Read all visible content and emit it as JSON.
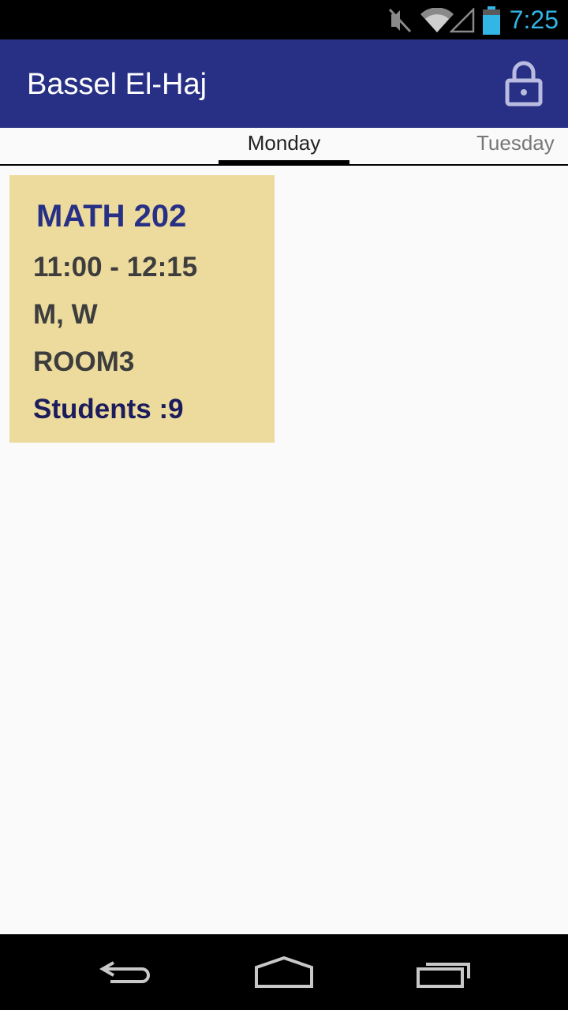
{
  "status_bar": {
    "time": "7:25",
    "icons": [
      "mute-icon",
      "wifi-icon",
      "signal-icon",
      "battery-icon"
    ],
    "time_color": "#33b5e5"
  },
  "app_bar": {
    "title": "Bassel El-Haj",
    "background": "#283085",
    "action_icon": "lock-icon"
  },
  "tabs": [
    {
      "label": "Monday",
      "selected": true
    },
    {
      "label": "Tuesday",
      "selected": false
    }
  ],
  "course": {
    "code": "MATH 202",
    "time": "11:00 - 12:15",
    "days": "M, W",
    "room": "ROOM3",
    "students": "Students :9",
    "card_color": "#ecdb9d"
  },
  "nav_bar": {
    "icons": [
      "back-icon",
      "home-icon",
      "recents-icon"
    ]
  }
}
